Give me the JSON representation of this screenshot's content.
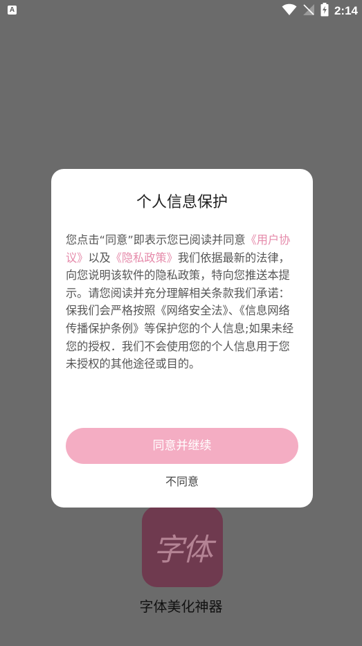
{
  "status_bar": {
    "left_icon_letter": "A",
    "wifi_icon": "wifi-icon",
    "signal_icon": "no-signal-icon",
    "battery_icon": "battery-charging-icon",
    "time": "2:14"
  },
  "dialog": {
    "title": "个人信息保护",
    "body_parts": {
      "p1": "您点击“同意”即表示您已阅读并同意",
      "link_user": "《用户协议》",
      "p2": "以及",
      "link_privacy": "《隐私政策》",
      "p3": "我们依据最新的法律，向您说明该软件的隐私政策，特向您推送本提示。请您阅读并充分理解相关条款我们承诺：",
      "p4": "保我们会严格按照《网络安全法》、《信息网络传播保护条例》等保护您的个人信息;如果未经您的授权．我们不会使用您的个人信息用于您未授权的其他途径或目的。"
    },
    "agree_label": "同意并继续",
    "disagree_label": "不同意"
  },
  "app": {
    "icon_text": "字体",
    "name": "字体美化神器"
  },
  "colors": {
    "overlay": "#6b6b6b",
    "accent": "#f4adc3",
    "link": "#e58aaa",
    "app_icon_bg": "#6f3a4f"
  }
}
